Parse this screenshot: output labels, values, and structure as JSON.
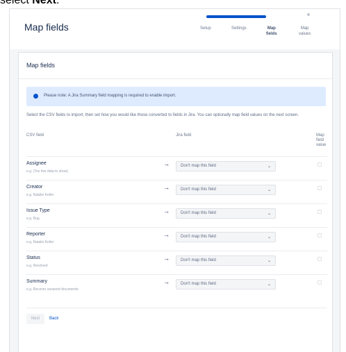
{
  "caption": {
    "prefix": "select ",
    "bold": "Next",
    "suffix": "."
  },
  "header": {
    "title": "Map fields"
  },
  "progress": {
    "fraction": 0.75
  },
  "steps": [
    {
      "label": "Setup"
    },
    {
      "label": "Settings"
    },
    {
      "label": "Map\nfields"
    },
    {
      "label": "Map\nvalues"
    }
  ],
  "card": {
    "title": "Map fields"
  },
  "note": {
    "text": "Please note: A Jira Summary field mapping is required to enable import."
  },
  "intro": "Select the CSV fields to import, then set how you would like those converted to fields in Jira. You can optionally map field values on the next screen.",
  "table": {
    "headers": {
      "csv": "CSV field",
      "jira": "Jira field",
      "map": "Map\nfield\nvalue"
    },
    "rows": [
      {
        "name": "Assignee",
        "example": "e.g. (Too few data to show)",
        "select": "Don't map this field"
      },
      {
        "name": "Creator",
        "example": "e.g. Natalie Keller",
        "select": "Don't map this field"
      },
      {
        "name": "Issue Type",
        "example": "e.g. Bug",
        "select": "Don't map this field"
      },
      {
        "name": "Reporter",
        "example": "e.g. Natalie Keller",
        "select": "Don't map this field"
      },
      {
        "name": "Status",
        "example": "e.g. Resolved",
        "select": "Don't map this field"
      },
      {
        "name": "Summary",
        "example": "e.g. Recover unsaved documents",
        "select": "Don't map this field"
      }
    ]
  },
  "footer": {
    "next": "Next",
    "back": "Back"
  }
}
